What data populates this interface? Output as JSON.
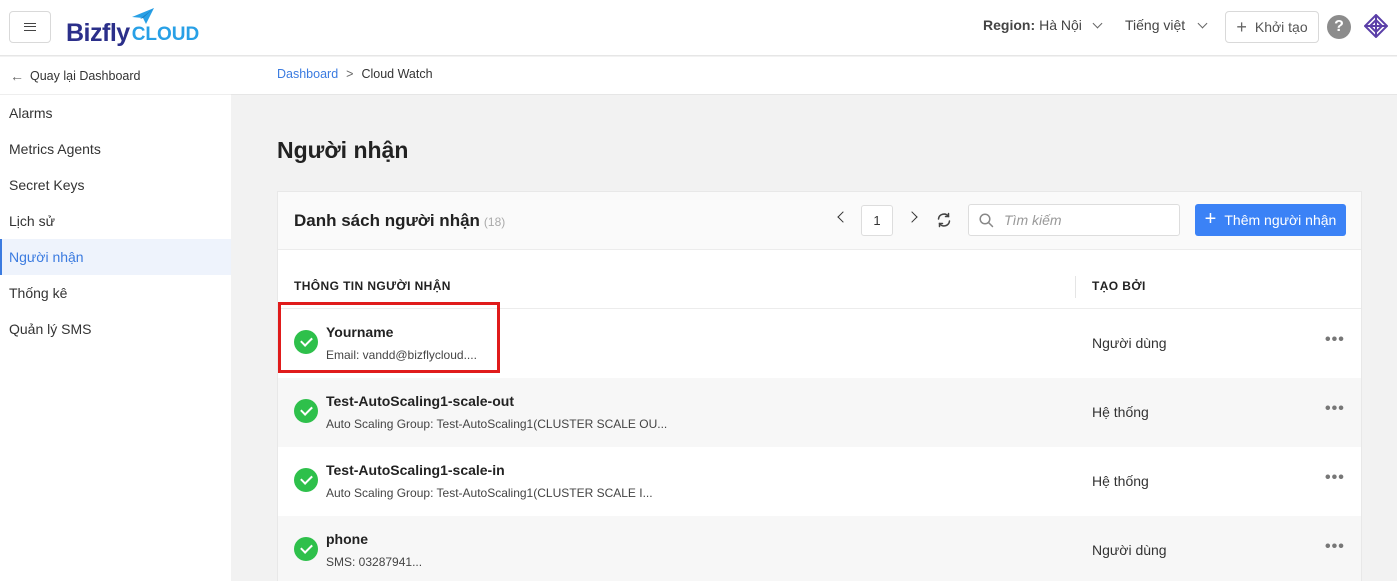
{
  "header": {
    "logo_main": "Bizfly",
    "logo_sub": "CLOUD",
    "region_label": "Region:",
    "region_value": "Hà Nội",
    "language": "Tiếng việt",
    "create_label": "Khởi tạo",
    "help_glyph": "?"
  },
  "sidebar": {
    "back_label": "Quay lại Dashboard",
    "items": [
      {
        "label": "Alarms"
      },
      {
        "label": "Metrics Agents"
      },
      {
        "label": "Secret Keys"
      },
      {
        "label": "Lịch sử"
      },
      {
        "label": "Người nhận"
      },
      {
        "label": "Thống kê"
      },
      {
        "label": "Quản lý SMS"
      }
    ],
    "active_index": 4
  },
  "breadcrumb": {
    "root": "Dashboard",
    "separator": ">",
    "current": "Cloud Watch"
  },
  "page_title": "Người nhận",
  "card": {
    "title": "Danh sách người nhận",
    "count": "(18)",
    "page": "1",
    "search_placeholder": "Tìm kiếm",
    "add_label": "Thêm người nhận",
    "columns": {
      "info": "THÔNG TIN NGƯỜI NHẬN",
      "created_by": "TẠO BỞI"
    },
    "rows": [
      {
        "name": "Yourname",
        "detail": "Email: vandd@bizflycloud....",
        "created_by": "Người dùng",
        "more": "•••"
      },
      {
        "name": "Test-AutoScaling1-scale-out",
        "detail": "Auto Scaling Group: Test-AutoScaling1(CLUSTER SCALE OU...",
        "created_by": "Hệ thống",
        "more": "•••"
      },
      {
        "name": "Test-AutoScaling1-scale-in",
        "detail": "Auto Scaling Group: Test-AutoScaling1(CLUSTER SCALE I...",
        "created_by": "Hệ thống",
        "more": "•••"
      },
      {
        "name": "phone",
        "detail": "SMS: 03287941...",
        "created_by": "Người dùng",
        "more": "•••"
      }
    ]
  },
  "colors": {
    "accent": "#3b82f6",
    "success": "#2ec04b",
    "highlight": "#e01b1b",
    "logo_dark": "#2b2f8a",
    "logo_light": "#28a0e6"
  }
}
